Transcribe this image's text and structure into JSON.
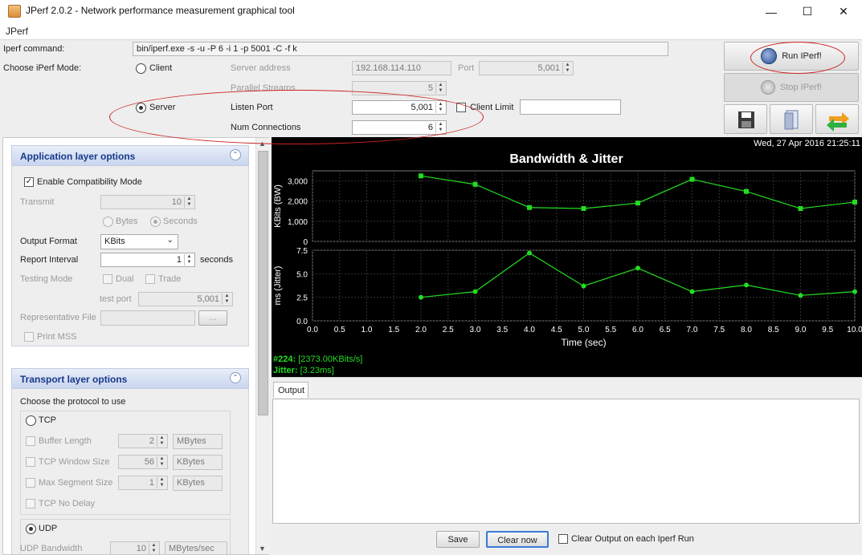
{
  "window": {
    "title": "JPerf 2.0.2 - Network performance measurement graphical tool",
    "minimize": "—",
    "maximize": "☐",
    "close": "✕"
  },
  "menu": {
    "items": [
      "JPerf"
    ]
  },
  "command": {
    "label": "Iperf command:",
    "value": "bin/iperf.exe -s -u -P 6 -i 1 -p 5001 -C -f k"
  },
  "mode": {
    "label": "Choose iPerf Mode:",
    "client_label": "Client",
    "server_label": "Server",
    "server_address_label": "Server address",
    "server_address_value": "192.168.114.110",
    "port_label": "Port",
    "port_value": "5,001",
    "parallel_label": "Parallel Streams",
    "parallel_value": "5",
    "listen_port_label": "Listen Port",
    "listen_port_value": "5,001",
    "client_limit_label": "Client Limit",
    "client_limit_value": "",
    "num_conn_label": "Num Connections",
    "num_conn_value": "6"
  },
  "actions": {
    "run": "Run IPerf!",
    "stop": "Stop IPerf!"
  },
  "app_layer": {
    "title": "Application layer options",
    "compat_label": "Enable Compatibility Mode",
    "transmit_label": "Transmit",
    "transmit_value": "10",
    "bytes_label": "Bytes",
    "seconds_label": "Seconds",
    "output_format_label": "Output Format",
    "output_format_value": "KBits",
    "report_interval_label": "Report Interval",
    "report_interval_value": "1",
    "report_interval_unit": "seconds",
    "testing_mode_label": "Testing Mode",
    "dual_label": "Dual",
    "trade_label": "Trade",
    "test_port_label": "test port",
    "test_port_value": "5,001",
    "rep_file_label": "Representative File",
    "rep_file_browse": "...",
    "print_mss_label": "Print MSS"
  },
  "transport": {
    "title": "Transport layer options",
    "choose_label": "Choose the protocol to use",
    "tcp_label": "TCP",
    "buffer_label": "Buffer Length",
    "buffer_value": "2",
    "buffer_unit": "MBytes",
    "window_label": "TCP Window Size",
    "window_value": "56",
    "window_unit": "KBytes",
    "mss_label": "Max Segment Size",
    "mss_value": "1",
    "mss_unit": "KBytes",
    "nodelay_label": "TCP No Delay",
    "udp_label": "UDP",
    "udp_bw_label": "UDP Bandwidth",
    "udp_bw_value": "10",
    "udp_bw_unit": "MBytes/sec"
  },
  "chart_meta": {
    "timestamp": "Wed, 27 Apr 2016 21:25:11",
    "status_id": "#224:",
    "status_bw": "[2373.00KBits/s]",
    "jitter_label": "Jitter:",
    "jitter_value": "[3.23ms]"
  },
  "chart_data": [
    {
      "type": "line",
      "title": "Bandwidth & Jitter",
      "ylabel": "KBits (BW)",
      "ylim": [
        0,
        3500
      ],
      "yticks": [
        "0",
        "1,000",
        "2,000",
        "3,000"
      ],
      "ytick_values": [
        0,
        1000,
        2000,
        3000
      ],
      "x": [
        2,
        3,
        4,
        5,
        6,
        7,
        8,
        9,
        10
      ],
      "values": [
        3250,
        2830,
        1680,
        1630,
        1900,
        3080,
        2480,
        1630,
        1950
      ],
      "color": "#22dd22",
      "marker": "square"
    },
    {
      "type": "line",
      "ylabel": "ms (Jitter)",
      "xlabel": "Time (sec)",
      "ylim": [
        0,
        7.5
      ],
      "yticks": [
        "0.0",
        "2.5",
        "5.0",
        "7.5"
      ],
      "ytick_values": [
        0,
        2.5,
        5,
        7.5
      ],
      "xlim": [
        0,
        10
      ],
      "xticks": [
        "0.0",
        "0.5",
        "1.0",
        "1.5",
        "2.0",
        "2.5",
        "3.0",
        "3.5",
        "4.0",
        "4.5",
        "5.0",
        "5.5",
        "6.0",
        "6.5",
        "7.0",
        "7.5",
        "8.0",
        "8.5",
        "9.0",
        "9.5",
        "10.0"
      ],
      "x": [
        2,
        3,
        4,
        5,
        6,
        7,
        8,
        9,
        10
      ],
      "values": [
        2.5,
        3.1,
        7.2,
        3.7,
        5.6,
        3.1,
        3.8,
        2.7,
        3.1
      ],
      "color": "#22dd22",
      "marker": "circle"
    }
  ],
  "output": {
    "tab_label": "Output",
    "text": "",
    "save_label": "Save",
    "clear_label": "Clear now",
    "clear_each_label": "Clear Output on each Iperf Run"
  }
}
